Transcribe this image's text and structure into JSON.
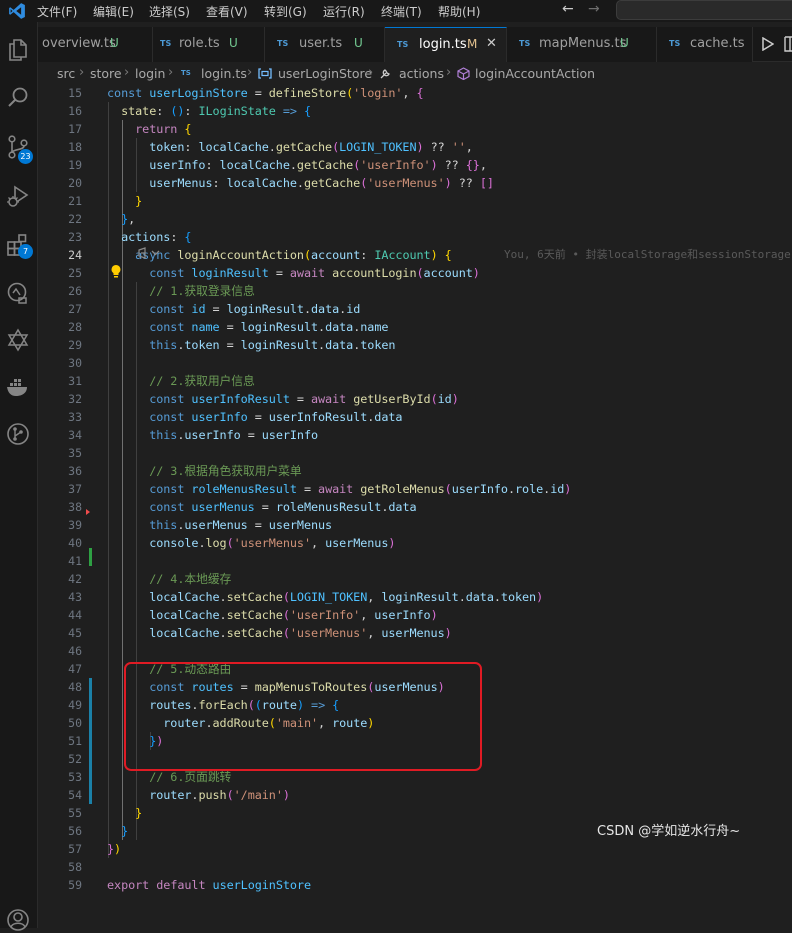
{
  "menu": [
    "文件(F)",
    "编辑(E)",
    "选择(S)",
    "查看(V)",
    "转到(G)",
    "运行(R)",
    "终端(T)",
    "帮助(H)"
  ],
  "activity_badges": {
    "source_control": "23",
    "extensions": "7"
  },
  "tabs": [
    {
      "name": "overview.ts",
      "status": "U",
      "icon": "",
      "active": false
    },
    {
      "name": "role.ts",
      "status": "U",
      "icon": "TS",
      "active": false
    },
    {
      "name": "user.ts",
      "status": "U",
      "icon": "TS",
      "active": false
    },
    {
      "name": "login.ts",
      "status": "M",
      "icon": "TS",
      "active": true
    },
    {
      "name": "mapMenus.ts",
      "status": "U",
      "icon": "TS",
      "active": false
    },
    {
      "name": "cache.ts",
      "status": "",
      "icon": "TS",
      "active": false
    }
  ],
  "breadcrumb": [
    "src",
    "store",
    "login",
    "login.ts",
    "userLoginStore",
    "actions",
    "loginAccountAction"
  ],
  "breadcrumb_file_icon": "TS",
  "current_line": "24",
  "blame": "You, 6天前 • 封装localStorage和sessionStorage",
  "lines": [
    [
      [
        "k",
        "const "
      ],
      [
        "c",
        "userLoginStore"
      ],
      [
        "o",
        " = "
      ],
      [
        "f",
        "defineStore"
      ],
      [
        "b1",
        "("
      ],
      [
        "s",
        "'login'"
      ],
      [
        "o",
        ", "
      ],
      [
        "b2",
        "{"
      ]
    ],
    [
      [
        "o",
        "  "
      ],
      [
        "f",
        "state"
      ],
      [
        "o",
        ": "
      ],
      [
        "b3",
        "()"
      ],
      [
        "o",
        ": "
      ],
      [
        "t",
        "ILoginState"
      ],
      [
        "o",
        " "
      ],
      [
        "k",
        "=>"
      ],
      [
        "o",
        " "
      ],
      [
        "b3",
        "{"
      ]
    ],
    [
      [
        "o",
        "    "
      ],
      [
        "kc",
        "return"
      ],
      [
        "o",
        " "
      ],
      [
        "b1",
        "{"
      ]
    ],
    [
      [
        "o",
        "      "
      ],
      [
        "v",
        "token"
      ],
      [
        "o",
        ": "
      ],
      [
        "v",
        "localCache"
      ],
      [
        "o",
        "."
      ],
      [
        "f",
        "getCache"
      ],
      [
        "b2",
        "("
      ],
      [
        "c",
        "LOGIN_TOKEN"
      ],
      [
        "b2",
        ")"
      ],
      [
        "o",
        " ?? "
      ],
      [
        "s",
        "''"
      ],
      [
        "o",
        ","
      ]
    ],
    [
      [
        "o",
        "      "
      ],
      [
        "v",
        "userInfo"
      ],
      [
        "o",
        ": "
      ],
      [
        "v",
        "localCache"
      ],
      [
        "o",
        "."
      ],
      [
        "f",
        "getCache"
      ],
      [
        "b2",
        "("
      ],
      [
        "s",
        "'userInfo'"
      ],
      [
        "b2",
        ")"
      ],
      [
        "o",
        " ?? "
      ],
      [
        "b2",
        "{}"
      ],
      [
        "o",
        ","
      ]
    ],
    [
      [
        "o",
        "      "
      ],
      [
        "v",
        "userMenus"
      ],
      [
        "o",
        ": "
      ],
      [
        "v",
        "localCache"
      ],
      [
        "o",
        "."
      ],
      [
        "f",
        "getCache"
      ],
      [
        "b2",
        "("
      ],
      [
        "s",
        "'userMenus'"
      ],
      [
        "b2",
        ")"
      ],
      [
        "o",
        " ?? "
      ],
      [
        "b2",
        "[]"
      ]
    ],
    [
      [
        "o",
        "    "
      ],
      [
        "b1",
        "}"
      ]
    ],
    [
      [
        "o",
        "  "
      ],
      [
        "b3",
        "}"
      ],
      [
        "o",
        ","
      ]
    ],
    [
      [
        "o",
        "  "
      ],
      [
        "v",
        "actions"
      ],
      [
        "o",
        ": "
      ],
      [
        "b3",
        "{"
      ]
    ],
    [
      [
        "o",
        "    "
      ],
      [
        "k",
        "async"
      ],
      [
        "o",
        " "
      ],
      [
        "f",
        "loginAccountAction"
      ],
      [
        "b1",
        "("
      ],
      [
        "v",
        "account"
      ],
      [
        "o",
        ": "
      ],
      [
        "t",
        "IAccount"
      ],
      [
        "b1",
        ")"
      ],
      [
        "o",
        " "
      ],
      [
        "b1",
        "{"
      ]
    ],
    [
      [
        "o",
        "      "
      ],
      [
        "k",
        "const"
      ],
      [
        "o",
        " "
      ],
      [
        "c",
        "loginResult"
      ],
      [
        "o",
        " = "
      ],
      [
        "kc",
        "await"
      ],
      [
        "o",
        " "
      ],
      [
        "f",
        "accountLogin"
      ],
      [
        "b2",
        "("
      ],
      [
        "v",
        "account"
      ],
      [
        "b2",
        ")"
      ]
    ],
    [
      [
        "o",
        "      "
      ],
      [
        "m",
        "// 1.获取登录信息"
      ]
    ],
    [
      [
        "o",
        "      "
      ],
      [
        "k",
        "const"
      ],
      [
        "o",
        " "
      ],
      [
        "c",
        "id"
      ],
      [
        "o",
        " = "
      ],
      [
        "v",
        "loginResult"
      ],
      [
        "o",
        "."
      ],
      [
        "v",
        "data"
      ],
      [
        "o",
        "."
      ],
      [
        "v",
        "id"
      ]
    ],
    [
      [
        "o",
        "      "
      ],
      [
        "k",
        "const"
      ],
      [
        "o",
        " "
      ],
      [
        "c",
        "name"
      ],
      [
        "o",
        " = "
      ],
      [
        "v",
        "loginResult"
      ],
      [
        "o",
        "."
      ],
      [
        "v",
        "data"
      ],
      [
        "o",
        "."
      ],
      [
        "v",
        "name"
      ]
    ],
    [
      [
        "o",
        "      "
      ],
      [
        "k",
        "this"
      ],
      [
        "o",
        "."
      ],
      [
        "v",
        "token"
      ],
      [
        "o",
        " = "
      ],
      [
        "v",
        "loginResult"
      ],
      [
        "o",
        "."
      ],
      [
        "v",
        "data"
      ],
      [
        "o",
        "."
      ],
      [
        "v",
        "token"
      ]
    ],
    [],
    [
      [
        "o",
        "      "
      ],
      [
        "m",
        "// 2.获取用户信息"
      ]
    ],
    [
      [
        "o",
        "      "
      ],
      [
        "k",
        "const"
      ],
      [
        "o",
        " "
      ],
      [
        "c",
        "userInfoResult"
      ],
      [
        "o",
        " = "
      ],
      [
        "kc",
        "await"
      ],
      [
        "o",
        " "
      ],
      [
        "f",
        "getUserById"
      ],
      [
        "b2",
        "("
      ],
      [
        "v",
        "id"
      ],
      [
        "b2",
        ")"
      ]
    ],
    [
      [
        "o",
        "      "
      ],
      [
        "k",
        "const"
      ],
      [
        "o",
        " "
      ],
      [
        "c",
        "userInfo"
      ],
      [
        "o",
        " = "
      ],
      [
        "v",
        "userInfoResult"
      ],
      [
        "o",
        "."
      ],
      [
        "v",
        "data"
      ]
    ],
    [
      [
        "o",
        "      "
      ],
      [
        "k",
        "this"
      ],
      [
        "o",
        "."
      ],
      [
        "v",
        "userInfo"
      ],
      [
        "o",
        " = "
      ],
      [
        "v",
        "userInfo"
      ]
    ],
    [],
    [
      [
        "o",
        "      "
      ],
      [
        "m",
        "// 3.根据角色获取用户菜单"
      ]
    ],
    [
      [
        "o",
        "      "
      ],
      [
        "k",
        "const"
      ],
      [
        "o",
        " "
      ],
      [
        "c",
        "roleMenusResult"
      ],
      [
        "o",
        " = "
      ],
      [
        "kc",
        "await"
      ],
      [
        "o",
        " "
      ],
      [
        "f",
        "getRoleMenus"
      ],
      [
        "b2",
        "("
      ],
      [
        "v",
        "userInfo"
      ],
      [
        "o",
        "."
      ],
      [
        "v",
        "role"
      ],
      [
        "o",
        "."
      ],
      [
        "v",
        "id"
      ],
      [
        "b2",
        ")"
      ]
    ],
    [
      [
        "o",
        "      "
      ],
      [
        "k",
        "const"
      ],
      [
        "o",
        " "
      ],
      [
        "c",
        "userMenus"
      ],
      [
        "o",
        " = "
      ],
      [
        "v",
        "roleMenusResult"
      ],
      [
        "o",
        "."
      ],
      [
        "v",
        "data"
      ]
    ],
    [
      [
        "o",
        "      "
      ],
      [
        "k",
        "this"
      ],
      [
        "o",
        "."
      ],
      [
        "v",
        "userMenus"
      ],
      [
        "o",
        " = "
      ],
      [
        "v",
        "userMenus"
      ]
    ],
    [
      [
        "o",
        "      "
      ],
      [
        "v",
        "console"
      ],
      [
        "o",
        "."
      ],
      [
        "f",
        "log"
      ],
      [
        "b2",
        "("
      ],
      [
        "s",
        "'userMenus'"
      ],
      [
        "o",
        ", "
      ],
      [
        "v",
        "userMenus"
      ],
      [
        "b2",
        ")"
      ]
    ],
    [],
    [
      [
        "o",
        "      "
      ],
      [
        "m",
        "// 4.本地缓存"
      ]
    ],
    [
      [
        "o",
        "      "
      ],
      [
        "v",
        "localCache"
      ],
      [
        "o",
        "."
      ],
      [
        "f",
        "setCache"
      ],
      [
        "b2",
        "("
      ],
      [
        "c",
        "LOGIN_TOKEN"
      ],
      [
        "o",
        ", "
      ],
      [
        "v",
        "loginResult"
      ],
      [
        "o",
        "."
      ],
      [
        "v",
        "data"
      ],
      [
        "o",
        "."
      ],
      [
        "v",
        "token"
      ],
      [
        "b2",
        ")"
      ]
    ],
    [
      [
        "o",
        "      "
      ],
      [
        "v",
        "localCache"
      ],
      [
        "o",
        "."
      ],
      [
        "f",
        "setCache"
      ],
      [
        "b2",
        "("
      ],
      [
        "s",
        "'userInfo'"
      ],
      [
        "o",
        ", "
      ],
      [
        "v",
        "userInfo"
      ],
      [
        "b2",
        ")"
      ]
    ],
    [
      [
        "o",
        "      "
      ],
      [
        "v",
        "localCache"
      ],
      [
        "o",
        "."
      ],
      [
        "f",
        "setCache"
      ],
      [
        "b2",
        "("
      ],
      [
        "s",
        "'userMenus'"
      ],
      [
        "o",
        ", "
      ],
      [
        "v",
        "userMenus"
      ],
      [
        "b2",
        ")"
      ]
    ],
    [],
    [
      [
        "o",
        "      "
      ],
      [
        "m",
        "// 5.动态路由"
      ]
    ],
    [
      [
        "o",
        "      "
      ],
      [
        "k",
        "const"
      ],
      [
        "o",
        " "
      ],
      [
        "c",
        "routes"
      ],
      [
        "o",
        " = "
      ],
      [
        "f",
        "mapMenusToRoutes"
      ],
      [
        "b2",
        "("
      ],
      [
        "v",
        "userMenus"
      ],
      [
        "b2",
        ")"
      ]
    ],
    [
      [
        "o",
        "      "
      ],
      [
        "v",
        "routes"
      ],
      [
        "o",
        "."
      ],
      [
        "f",
        "forEach"
      ],
      [
        "b2",
        "("
      ],
      [
        "b3",
        "("
      ],
      [
        "v",
        "route"
      ],
      [
        "b3",
        ")"
      ],
      [
        "o",
        " "
      ],
      [
        "k",
        "=>"
      ],
      [
        "o",
        " "
      ],
      [
        "b3",
        "{"
      ]
    ],
    [
      [
        "o",
        "        "
      ],
      [
        "v",
        "router"
      ],
      [
        "o",
        "."
      ],
      [
        "f",
        "addRoute"
      ],
      [
        "b1",
        "("
      ],
      [
        "s",
        "'main'"
      ],
      [
        "o",
        ", "
      ],
      [
        "v",
        "route"
      ],
      [
        "b1",
        ")"
      ]
    ],
    [
      [
        "o",
        "      "
      ],
      [
        "b3",
        "}"
      ],
      [
        "b2",
        ")"
      ]
    ],
    [],
    [
      [
        "o",
        "      "
      ],
      [
        "m",
        "// 6.页面跳转"
      ]
    ],
    [
      [
        "o",
        "      "
      ],
      [
        "v",
        "router"
      ],
      [
        "o",
        "."
      ],
      [
        "f",
        "push"
      ],
      [
        "b2",
        "("
      ],
      [
        "s",
        "'/main'"
      ],
      [
        "b2",
        ")"
      ]
    ],
    [
      [
        "o",
        "    "
      ],
      [
        "b1",
        "}"
      ]
    ],
    [
      [
        "o",
        "  "
      ],
      [
        "b3",
        "}"
      ]
    ],
    [
      [
        "b2",
        "}"
      ],
      [
        "b1",
        ")"
      ]
    ],
    [],
    [
      [
        "kc",
        "export"
      ],
      [
        "o",
        " "
      ],
      [
        "kc",
        "default"
      ],
      [
        "o",
        " "
      ],
      [
        "c",
        "userLoginStore"
      ]
    ]
  ],
  "watermark": "CSDN @学如逆水行舟~"
}
